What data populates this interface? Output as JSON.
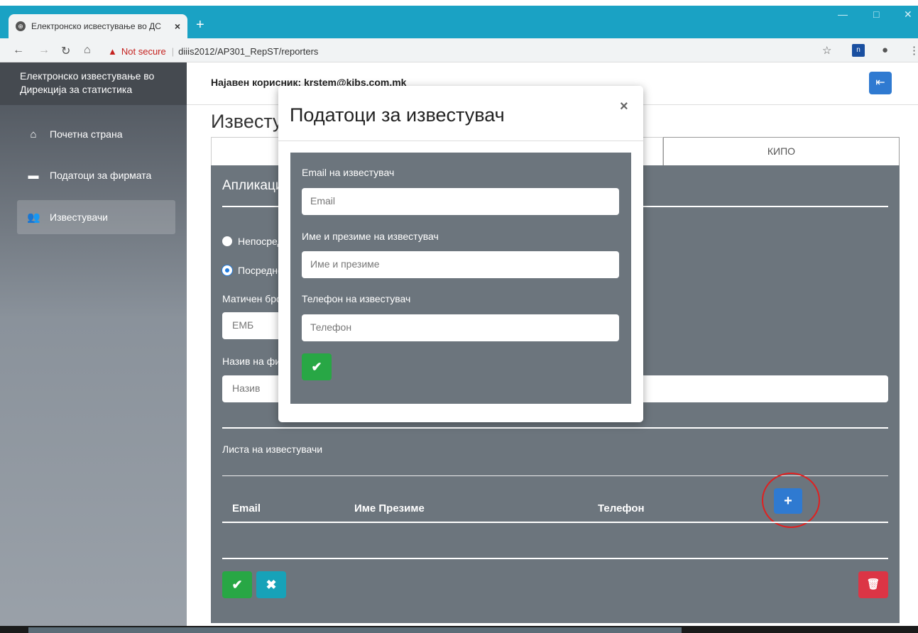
{
  "browser": {
    "tab_title": "Електронско исвестување во ДС",
    "tab_close": "×",
    "new_tab": "+",
    "not_secure": "Not secure",
    "url": "diiis2012/AP301_RepST/reporters",
    "win_min": "—",
    "win_max": "□",
    "win_close": "✕"
  },
  "sidebar": {
    "brand": "Електронско известување во Дирекција за статистика",
    "items": [
      {
        "label": "Почетна страна",
        "icon": "home-icon"
      },
      {
        "label": "Податоци за фирмата",
        "icon": "briefcase-icon"
      },
      {
        "label": "Известувачи",
        "icon": "users-icon"
      }
    ]
  },
  "header": {
    "user_label": "Најавен корисник: krstem@kibs.com.mk"
  },
  "page": {
    "title": "Известувачи",
    "tab_kipo": "КИПО",
    "section_heading": "Апликација",
    "radio_1": "Непосредно",
    "radio_2": "Посредно",
    "emb_label": "Матичен број",
    "emb_placeholder": "ЕМБ",
    "name_label": "Назив на фирма",
    "name_placeholder": "Назив",
    "list_title": "Листа на известувачи",
    "col_email": "Email",
    "col_name": "Име Презиме",
    "col_phone": "Телефон",
    "add_btn": "+",
    "save_btn": "✔",
    "cancel_btn": "✖",
    "delete_btn": "🗑"
  },
  "modal": {
    "title": "Податоци за известувач",
    "close": "×",
    "email_label": "Email на известувач",
    "email_placeholder": "Email",
    "name_label": "Име и презиме на известувач",
    "name_placeholder": "Име и презиме",
    "phone_label": "Телефон на известувач",
    "phone_placeholder": "Телефон",
    "ok": "✔"
  }
}
